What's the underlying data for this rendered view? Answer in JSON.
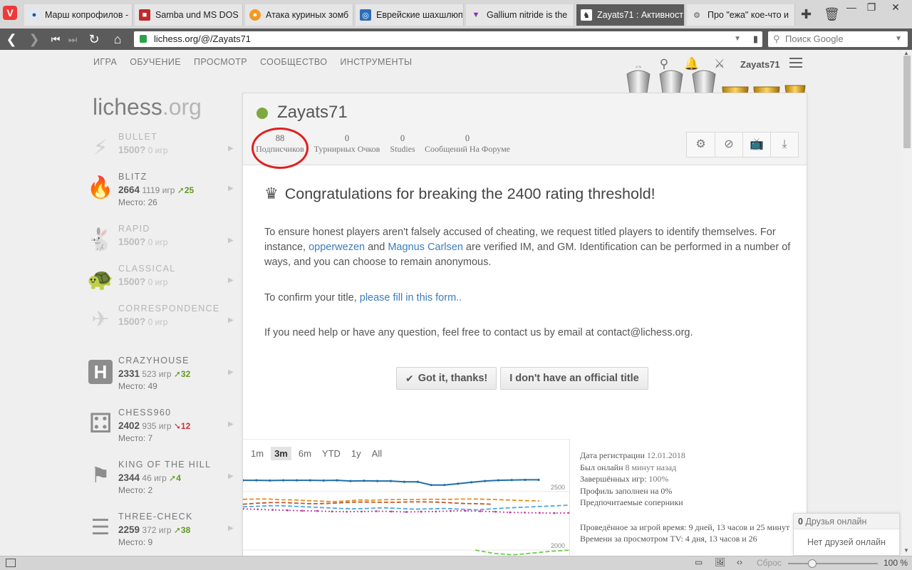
{
  "browser": {
    "tabs": [
      {
        "title": "Марш копрофилов -",
        "icon": "user-icon"
      },
      {
        "title": "Samba und MS DOS",
        "icon": "bookmark-red-icon"
      },
      {
        "title": "Атака куриных зомб",
        "icon": "pizza-icon"
      },
      {
        "title": "Еврейские шахшлюп",
        "icon": "blue-globe-icon"
      },
      {
        "title": "Gallium nitride is the",
        "icon": "triangle-icon"
      },
      {
        "title": "Zayats71 : Активност",
        "icon": "knight-icon",
        "active": true
      },
      {
        "title": "Про \"ежа\" кое-что и",
        "icon": "gear-icon"
      }
    ],
    "url": "lichess.org/@/Zayats71",
    "search_placeholder": "Поиск Google",
    "zoom": "100 %",
    "reset_label": "Сброс"
  },
  "nav": {
    "items": [
      "ИГРА",
      "ОБУЧЕНИЕ",
      "ПРОСМОТР",
      "СООБЩЕСТВО",
      "ИНСТРУМЕНТЫ"
    ],
    "username": "Zayats71"
  },
  "brand": {
    "main": "lichess",
    "tld": ".org"
  },
  "perfs": [
    {
      "name": "BULLET",
      "rating": "1500?",
      "games": "0 игр",
      "prog": "",
      "rank": "",
      "dim": true,
      "icon": "lightning-icon"
    },
    {
      "name": "BLITZ",
      "rating": "2664",
      "games": "1119 игр",
      "prog": "25",
      "prog_dir": "up",
      "rank": "Место: 26",
      "dim": false,
      "icon": "fire-icon"
    },
    {
      "name": "RAPID",
      "rating": "1500?",
      "games": "0 игр",
      "prog": "",
      "rank": "",
      "dim": true,
      "icon": "rabbit-icon"
    },
    {
      "name": "CLASSICAL",
      "rating": "1500?",
      "games": "0 игр",
      "prog": "",
      "rank": "",
      "dim": true,
      "icon": "turtle-icon"
    },
    {
      "name": "CORRESPONDENCE",
      "rating": "1500?",
      "games": "0 игр",
      "prog": "",
      "rank": "",
      "dim": true,
      "icon": "paper-plane-icon"
    },
    {
      "name": "CRAZYHOUSE",
      "rating": "2331",
      "games": "523 игр",
      "prog": "32",
      "prog_dir": "up",
      "rank": "Место: 49",
      "dim": false,
      "icon": "crazyhouse-icon"
    },
    {
      "name": "CHESS960",
      "rating": "2402",
      "games": "935 игр",
      "prog": "12",
      "prog_dir": "down",
      "rank": "Место: 7",
      "dim": false,
      "icon": "dice-icon"
    },
    {
      "name": "KING OF THE HILL",
      "rating": "2344",
      "games": "46 игр",
      "prog": "4",
      "prog_dir": "up",
      "rank": "Место: 2",
      "dim": false,
      "icon": "flag-icon"
    },
    {
      "name": "THREE-CHECK",
      "rating": "2259",
      "games": "372 игр",
      "prog": "38",
      "prog_dir": "up",
      "rank": "Место: 9",
      "dim": false,
      "icon": "three-check-icon"
    }
  ],
  "profile": {
    "username": "Zayats71",
    "stats": [
      {
        "num": "88",
        "label": "Подписчиков"
      },
      {
        "num": "0",
        "label": "Турнирных Очков"
      },
      {
        "num": "0",
        "label": "Studies"
      },
      {
        "num": "0",
        "label": "Сообщений На Форуме"
      }
    ]
  },
  "notice": {
    "title": "Congratulations for breaking the 2400 rating threshold!",
    "p1_a": "To ensure honest players aren't falsely accused of cheating, we request titled players to identify themselves. For instance, ",
    "link1": "opperwezen",
    "p1_b": " and ",
    "link2": "Magnus Carlsen",
    "p1_c": " are verified IM, and GM. Identification can be performed in a number of ways, and you can choose to remain anonymous.",
    "p2_a": "To confirm your title, ",
    "link3": "please fill in this form..",
    "p3": "If you need help or have any question, feel free to contact us by email at contact@lichess.org.",
    "btn_ok": "Got it, thanks!",
    "btn_no": "I don't have an official title"
  },
  "ranges": [
    "1m",
    "3m",
    "6m",
    "YTD",
    "1y",
    "All"
  ],
  "selected_range": "3m",
  "chart_data": {
    "type": "line",
    "ytick_labels": [
      "2500",
      "2000"
    ],
    "series": [
      {
        "color": "#1f6fa8",
        "dash": "solid",
        "values": [
          2596,
          2596,
          2594,
          2596,
          2596,
          2596,
          2594,
          2596,
          2590,
          2592,
          2590,
          2590,
          2583,
          2583,
          2556,
          2556,
          2567,
          2579,
          2590,
          2596,
          2598,
          2600,
          2600
        ]
      },
      {
        "color": "#e0901c",
        "dash": "dashed",
        "values": [
          2434,
          2436,
          2436,
          2430,
          2428,
          2422,
          2418,
          2414,
          2420,
          2428,
          2426,
          2430,
          2432,
          2432,
          2434,
          2434,
          2434,
          2436,
          2436,
          2434,
          2430,
          2426,
          2422,
          2420
        ]
      },
      {
        "color": "#c0582c",
        "dash": "dashed",
        "values": [
          2392,
          2400,
          2406,
          2406,
          2400,
          2396,
          2398,
          2404,
          2410,
          2410,
          2408,
          2408,
          2412,
          2412,
          2410,
          2404,
          2398,
          2396,
          2392
        ]
      },
      {
        "color": "#4ea7e0",
        "dash": "dashed",
        "values": [
          2370,
          2375,
          2380,
          2376,
          2370,
          2364,
          2358,
          2352,
          2356,
          2362,
          2356,
          2350,
          2352,
          2356,
          2350,
          2344,
          2352,
          2360,
          2366,
          2372,
          2378,
          2384
        ]
      },
      {
        "color": "#c03fa0",
        "dash": "dotted",
        "values": [
          2352,
          2348,
          2344,
          2340,
          2336,
          2334,
          2330,
          2328,
          2330,
          2332,
          2330,
          2326,
          2328,
          2330,
          2334,
          2336,
          2332,
          2328,
          2322,
          2320,
          2318,
          2316,
          2318
        ]
      },
      {
        "color": "#6bcf4a",
        "dash": "dashed",
        "values": [
          2000,
          1972,
          1960,
          1974,
          1990,
          2000
        ]
      }
    ]
  },
  "info": {
    "reg_label": "Дата регистрации",
    "reg_value": "12.01.2018",
    "online_label": "Был онлайн",
    "online_value": "8 минут назад",
    "completed_label": "Завершённых игр:",
    "completed_value": "100%",
    "profile_fill": "Профиль заполнен на 0%",
    "opponents": "Предпочитаемые соперники",
    "play_time": "Проведённое за игрой время: 9 дней, 13 часов и 25 минут",
    "tv_time": "Времени за просмотром TV: 4 дня, 13 часов и 26"
  },
  "friends": {
    "count": "0",
    "head": "Друзья онлайн",
    "empty": "Нет друзей онлайн"
  }
}
